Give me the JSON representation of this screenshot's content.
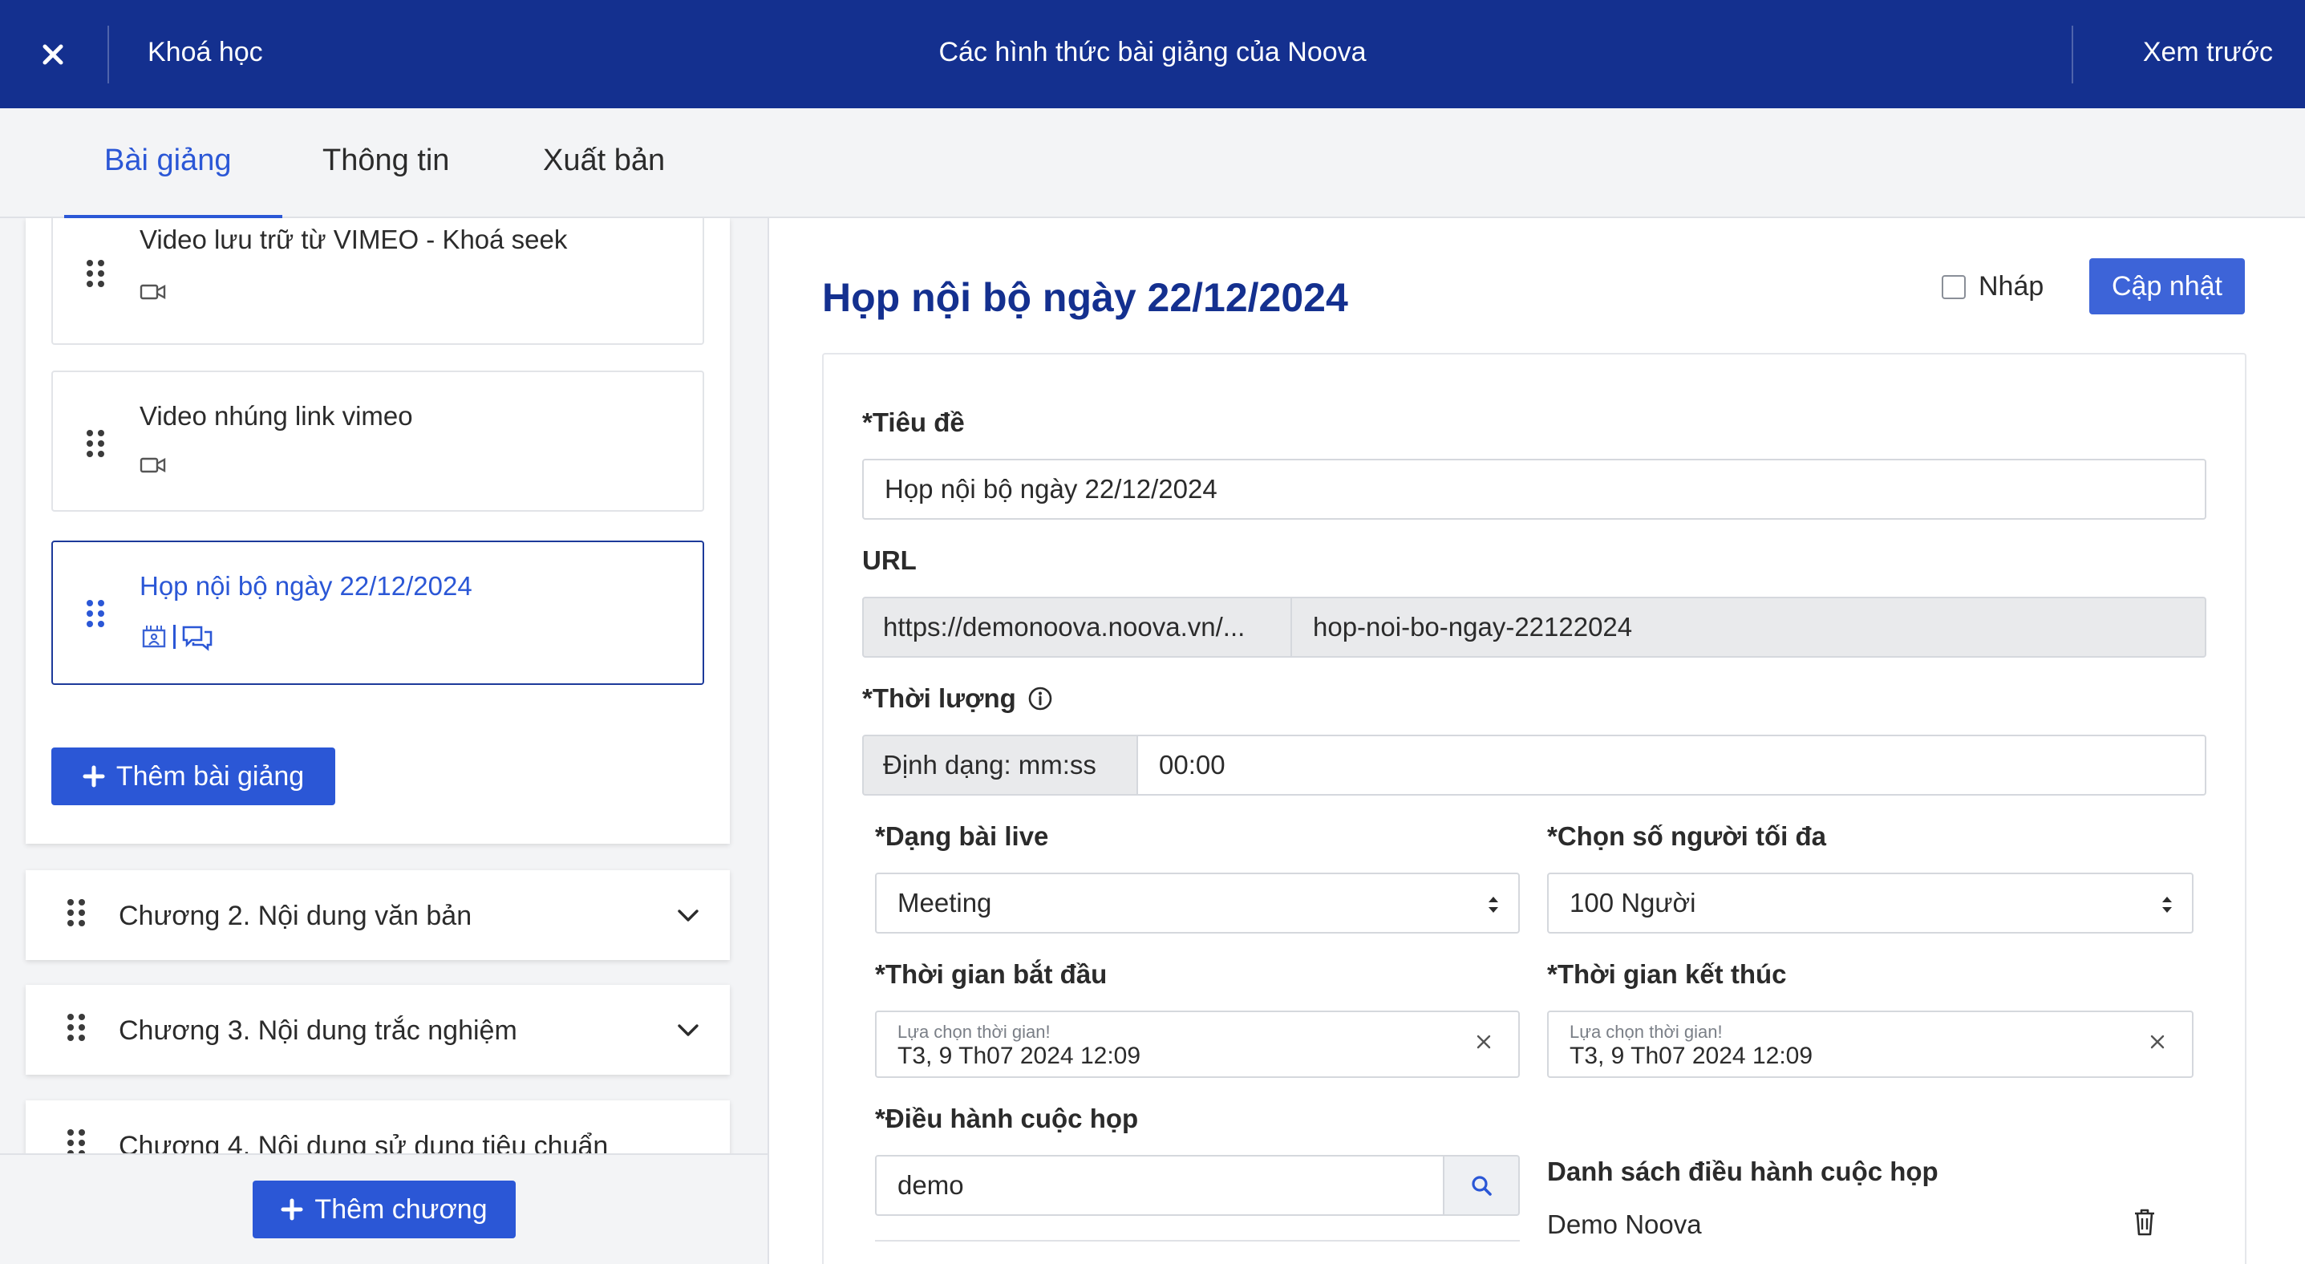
{
  "header": {
    "back_label": "Khoá học",
    "title": "Các hình thức bài giảng của Noova",
    "preview_label": "Xem trước"
  },
  "tabs": [
    {
      "label": "Bài giảng",
      "active": true
    },
    {
      "label": "Thông tin",
      "active": false
    },
    {
      "label": "Xuất bản",
      "active": false
    }
  ],
  "sidebar": {
    "lessons": [
      {
        "name": "Video lưu trữ từ VIMEO - Khoá seek",
        "icon": "video-icon"
      },
      {
        "name": "Video nhúng link vimeo",
        "icon": "video-icon"
      },
      {
        "name": "Họp nội bộ ngày 22/12/2024",
        "icon": "meeting-icon",
        "active": true
      }
    ],
    "add_lesson_label": "Thêm bài giảng",
    "chapters": [
      {
        "name": "Chương 2. Nội dung văn bản"
      },
      {
        "name": "Chương 3. Nội dung trắc nghiệm"
      },
      {
        "name": "Chương 4. Nội dung sử dụng tiêu chuẩn"
      }
    ],
    "add_chapter_label": "Thêm chương"
  },
  "editor": {
    "page_title": "Họp nội bộ ngày 22/12/2024",
    "draft_label": "Nháp",
    "draft_checked": false,
    "update_label": "Cập nhật",
    "title_label": "*Tiêu đề",
    "title_value": "Họp nội bộ ngày 22/12/2024",
    "url_label": "URL",
    "url_prefix": "https://demonoova.noova.vn/...",
    "url_slug": "hop-noi-bo-ngay-22122024",
    "duration_label": "*Thời lượng",
    "duration_format": "Định dạng: mm:ss",
    "duration_value": "00:00",
    "live_type_label": "*Dạng bài live",
    "live_type_value": "Meeting",
    "max_people_label": "*Chọn số người tối đa",
    "max_people_value": "100 Người",
    "start_label": "*Thời gian bắt đầu",
    "start_hint": "Lựa chọn thời gian!",
    "start_value": "T3, 9 Th07 2024 12:09",
    "end_label": "*Thời gian kết thúc",
    "end_hint": "Lựa chọn thời gian!",
    "end_value": "T3, 9 Th07 2024 12:09",
    "host_label": "*Điều hành cuộc họp",
    "host_search_value": "demo",
    "host_list_title": "Danh sách điều hành cuộc họp",
    "host_list": [
      "Demo Noova"
    ]
  },
  "colors": {
    "header_bg": "#14308f",
    "accent": "#2b57d6",
    "title_color": "#14308f"
  }
}
